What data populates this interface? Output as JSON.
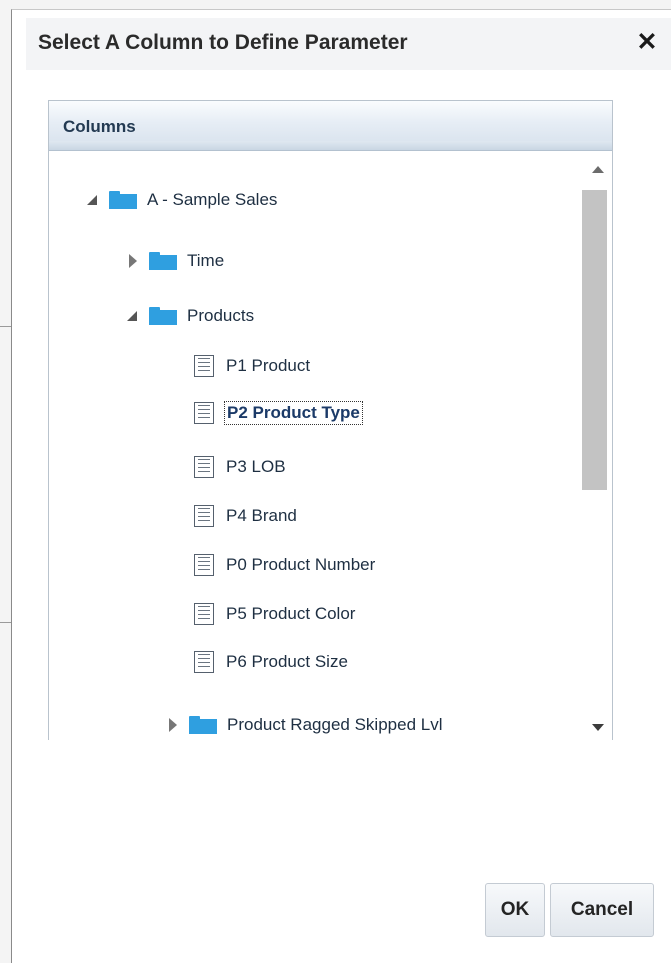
{
  "dialog": {
    "title": "Select A Column to Define Parameter",
    "close_glyph": "✕"
  },
  "panel": {
    "header": "Columns"
  },
  "tree": {
    "root": {
      "label": "A - Sample Sales",
      "expanded": true,
      "icon": "folder-icon"
    },
    "time": {
      "label": "Time",
      "expanded": false,
      "icon": "folder-icon"
    },
    "products": {
      "label": "Products",
      "expanded": true,
      "icon": "folder-icon"
    },
    "columns": [
      {
        "label": "P1 Product",
        "icon": "column-icon",
        "selected": false
      },
      {
        "label": "P2 Product Type",
        "icon": "column-icon",
        "selected": true
      },
      {
        "label": "P3 LOB",
        "icon": "column-icon",
        "selected": false
      },
      {
        "label": "P4 Brand",
        "icon": "column-icon",
        "selected": false
      },
      {
        "label": "P0 Product Number",
        "icon": "column-icon",
        "selected": false
      },
      {
        "label": "P5 Product Color",
        "icon": "column-icon",
        "selected": false
      },
      {
        "label": "P6 Product Size",
        "icon": "column-icon",
        "selected": false
      }
    ],
    "ragged": {
      "label": "Product Ragged Skipped Lvl",
      "expanded": false,
      "icon": "folder-icon"
    }
  },
  "buttons": {
    "ok": "OK",
    "cancel": "Cancel"
  },
  "colors": {
    "folder": "#2f9fe0",
    "header_text": "#233a52",
    "scroll_thumb": "#c3c3c3"
  }
}
